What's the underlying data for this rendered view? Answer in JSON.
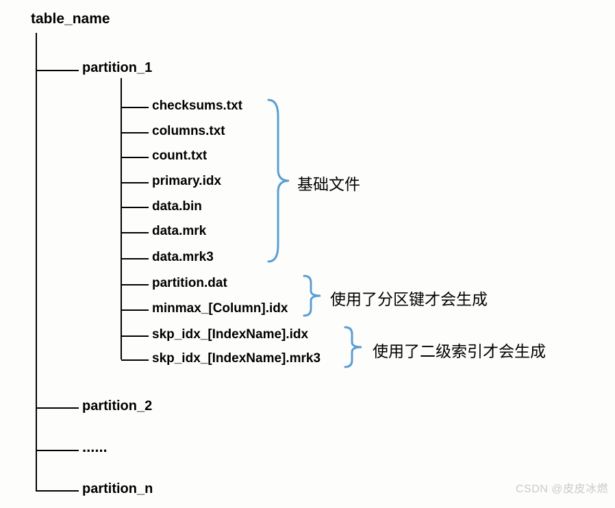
{
  "root": {
    "label": "table_name"
  },
  "partitions": {
    "p1": "partition_1",
    "p2": "partition_2",
    "dots": "......",
    "pn": "partition_n"
  },
  "files": {
    "checksums": "checksums.txt",
    "columns": "columns.txt",
    "count": "count.txt",
    "primary": "primary.idx",
    "databin": "data.bin",
    "datamrk": "data.mrk",
    "datamrk3": "data.mrk3",
    "partitiondat": "partition.dat",
    "minmax": "minmax_[Column].idx",
    "skpidx": "skp_idx_[IndexName].idx",
    "skpmrk3": "skp_idx_[IndexName].mrk3"
  },
  "annotations": {
    "basic": "基础文件",
    "partition_key": "使用了分区键才会生成",
    "secondary_index": "使用了二级索引才会生成"
  },
  "watermark": "CSDN @皮皮冰燃"
}
